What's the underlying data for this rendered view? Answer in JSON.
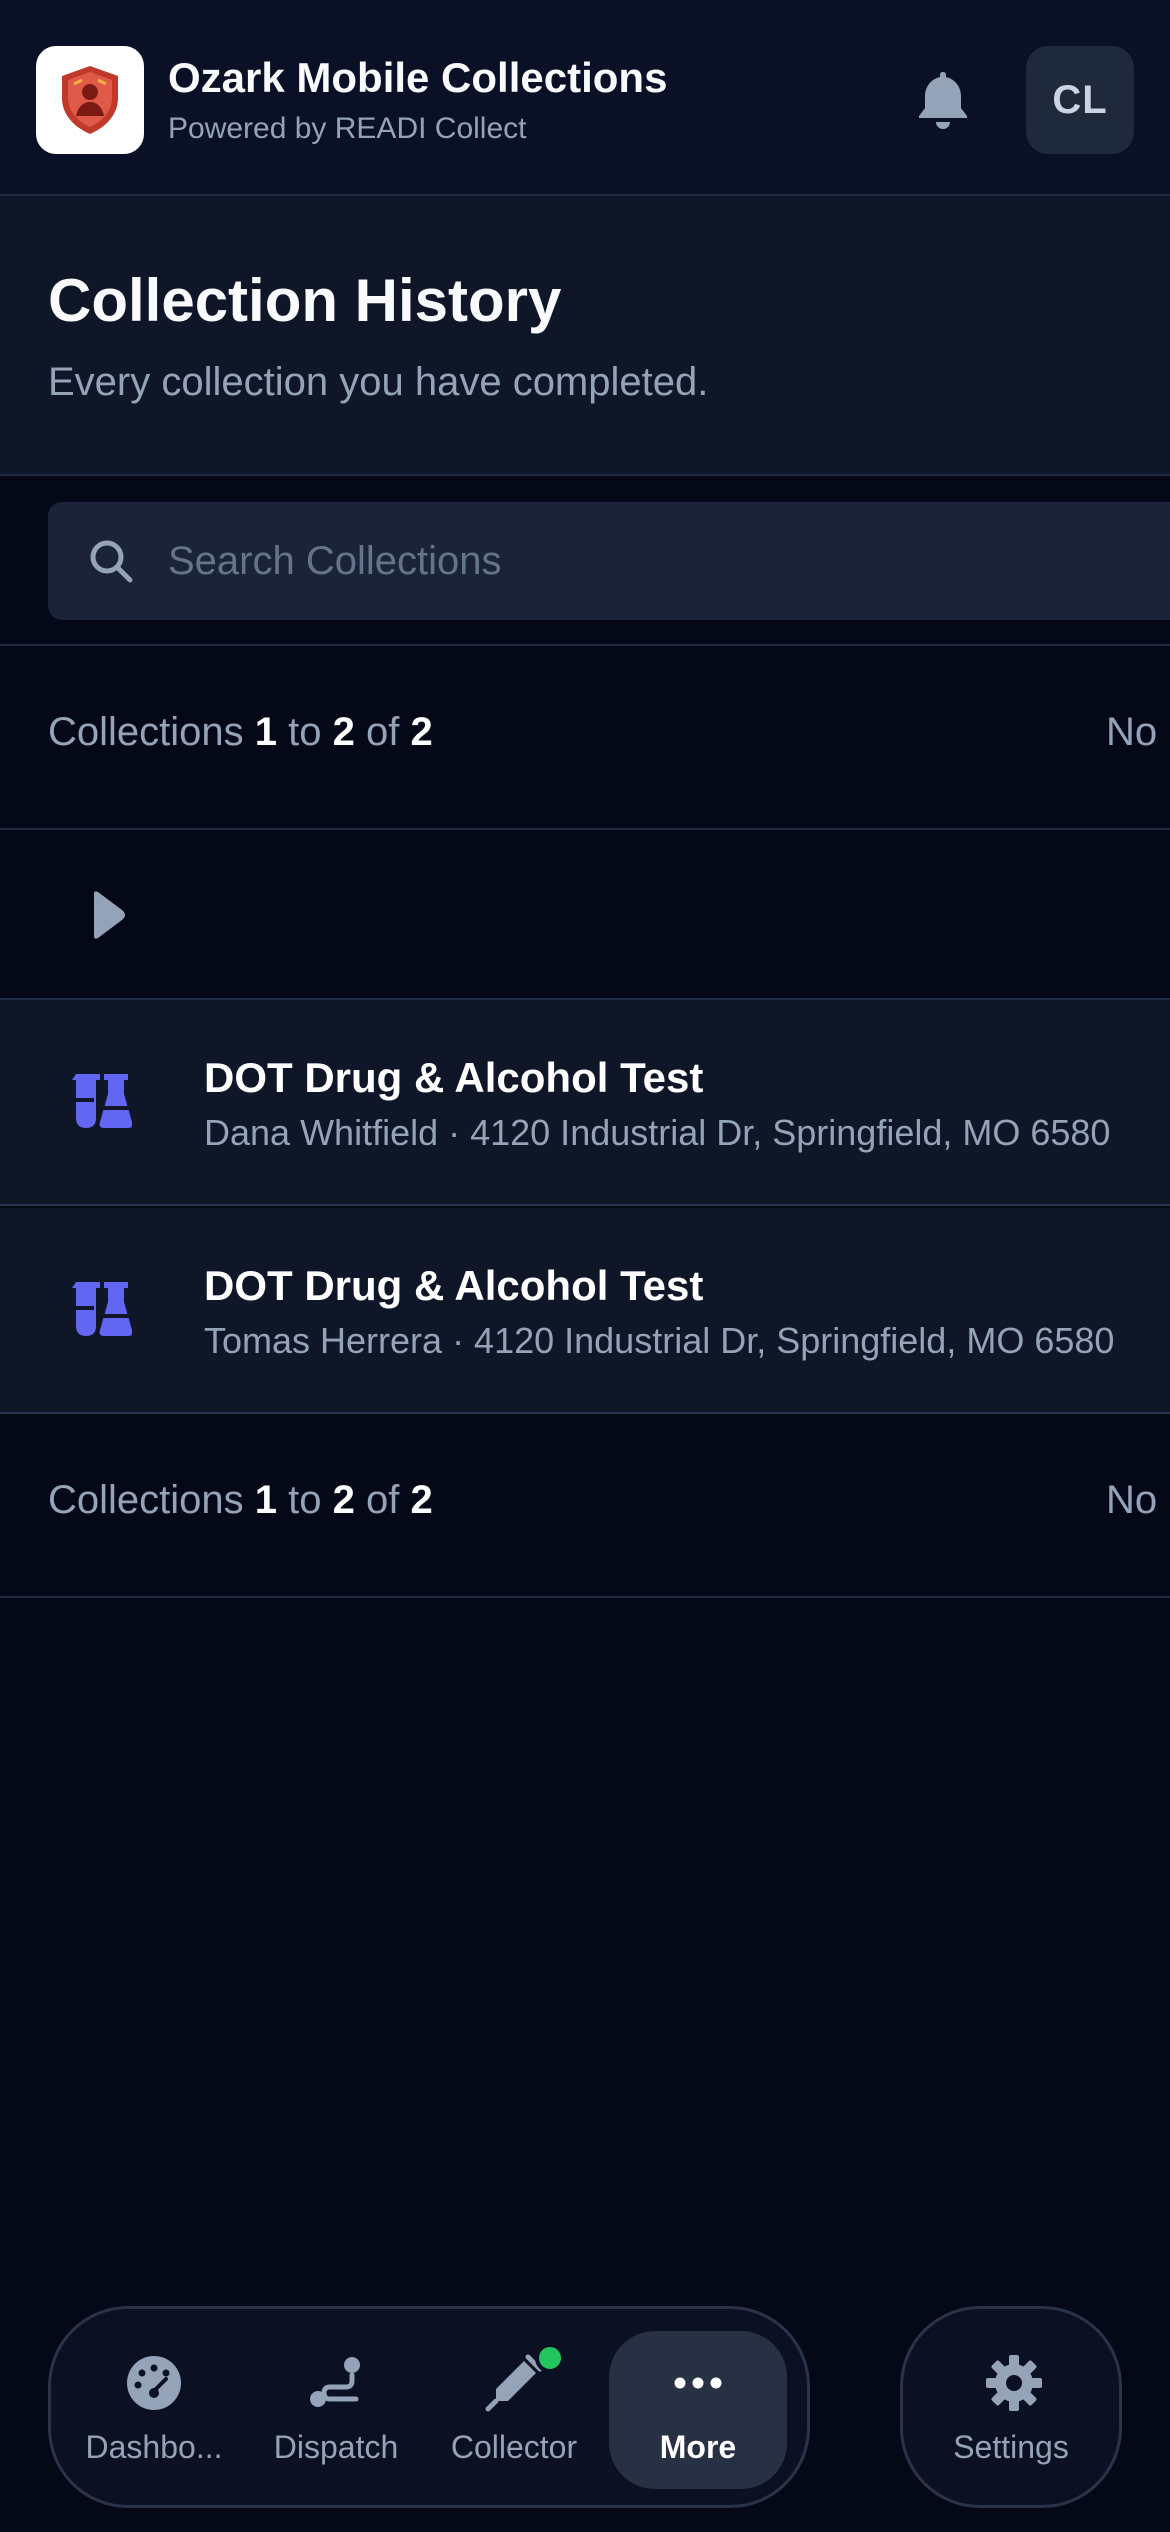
{
  "header": {
    "app_title": "Ozark Mobile Collections",
    "app_subtitle": "Powered by READI Collect",
    "logo_icon": "shield-person-icon",
    "notifications_icon": "bell-icon",
    "avatar_initials": "CL"
  },
  "page": {
    "title": "Collection History",
    "subtitle": "Every collection you have completed."
  },
  "search": {
    "placeholder": "Search Collections",
    "value": ""
  },
  "pager": {
    "label": "Collections",
    "from": "1",
    "to_word": "to",
    "to": "2",
    "of_word": "of",
    "total": "2",
    "right_label": "No"
  },
  "collections": [
    {
      "icon": "flask-icon",
      "title": "DOT Drug & Alcohol Test",
      "subtitle": "Dana Whitfield · 4120 Industrial Dr, Springfield, MO 6580"
    },
    {
      "icon": "flask-icon",
      "title": "DOT Drug & Alcohol Test",
      "subtitle": "Tomas Herrera · 4120 Industrial Dr, Springfield, MO 6580"
    }
  ],
  "nav": {
    "items": [
      {
        "label": "Dashbo...",
        "icon": "gauge-icon"
      },
      {
        "label": "Dispatch",
        "icon": "route-icon"
      },
      {
        "label": "Collector",
        "icon": "syringe-icon"
      },
      {
        "label": "More",
        "icon": "more-icon"
      }
    ],
    "settings_label": "Settings",
    "settings_icon": "gear-icon",
    "active": "More"
  },
  "colors": {
    "background": "#040817",
    "header_bg": "#0a1126",
    "accent_icon": "#6366f1",
    "status_online": "#22c55e",
    "logo_shield": "#c0392b"
  }
}
